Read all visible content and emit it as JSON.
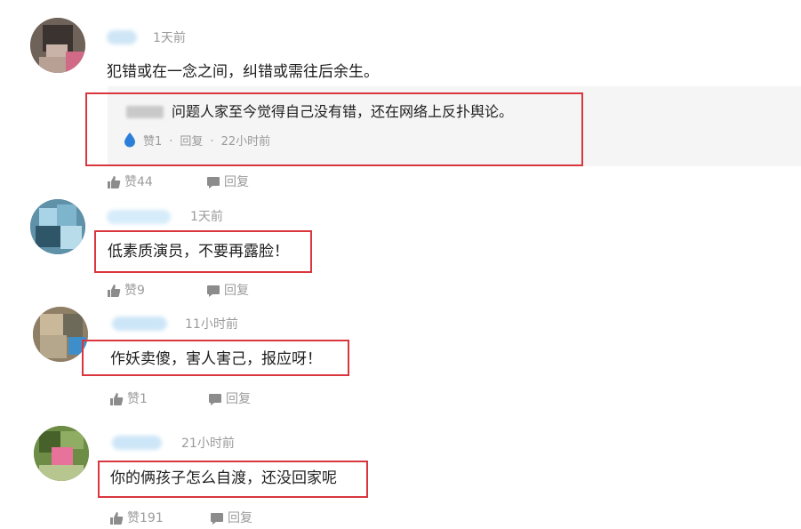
{
  "comments": [
    {
      "time": "1天前",
      "content": "犯错或在一念之间，纠错或需往后余生。",
      "reply": {
        "text": "问题人家至今觉得自己没有错，还在网络上反扑舆论。",
        "likes": "赞1",
        "reply_label": "回复",
        "time": "22小时前",
        "sep": "·"
      },
      "likes": "赞44",
      "reply_label": "回复"
    },
    {
      "time": "1天前",
      "content": "低素质演员，不要再露脸！",
      "likes": "赞9",
      "reply_label": "回复"
    },
    {
      "time": "11小时前",
      "content": "作妖卖傻，害人害己，报应呀！",
      "likes": "赞1",
      "reply_label": "回复"
    },
    {
      "time": "21小时前",
      "content": "你的俩孩子怎么自渡，还没回家呢",
      "likes": "赞191",
      "reply_label": "回复"
    }
  ],
  "colors": {
    "highlight_border": "#d9363e",
    "meta_text": "#9a9a9a",
    "reply_bg": "#f5f5f5"
  },
  "icons": {
    "like": "thumbs-up-icon",
    "reply": "comment-bubble-icon",
    "reply_like": "water-drop-icon"
  }
}
